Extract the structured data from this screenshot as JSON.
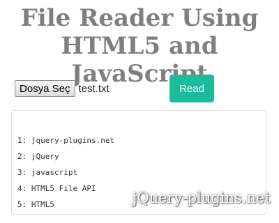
{
  "header": {
    "title_line1": "File Reader Using",
    "title_line2": "HTML5 and JavaScript"
  },
  "file_input": {
    "button_label": "Dosya Seç",
    "selected_file": "test.txt"
  },
  "read_button": {
    "label": "Read",
    "color": "#1abc9c"
  },
  "output": {
    "lines": [
      "1: jquery-plugins.net",
      "2: jQuery",
      "3: javascript",
      "4: HTML5 File API",
      "5: HTML5"
    ]
  },
  "watermark": "jQuery-plugins.net"
}
